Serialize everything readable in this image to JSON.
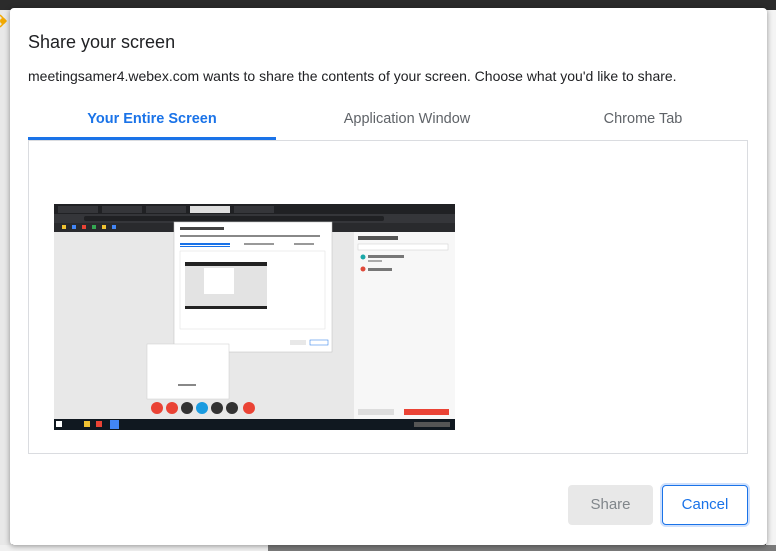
{
  "dialog": {
    "title": "Share your screen",
    "description": "meetingsamer4.webex.com wants to share the contents of your screen. Choose what you'd like to share.",
    "tabs": [
      {
        "label": "Your Entire Screen",
        "active": true
      },
      {
        "label": "Application Window",
        "active": false
      },
      {
        "label": "Chrome Tab",
        "active": false
      }
    ],
    "share_label": "Share",
    "cancel_label": "Cancel"
  },
  "colors": {
    "accent": "#1a73e8",
    "disabled_button": "#e8e8e8",
    "tab_inactive": "#5f6368"
  },
  "icons": [
    "screen-preview-thumbnail"
  ]
}
